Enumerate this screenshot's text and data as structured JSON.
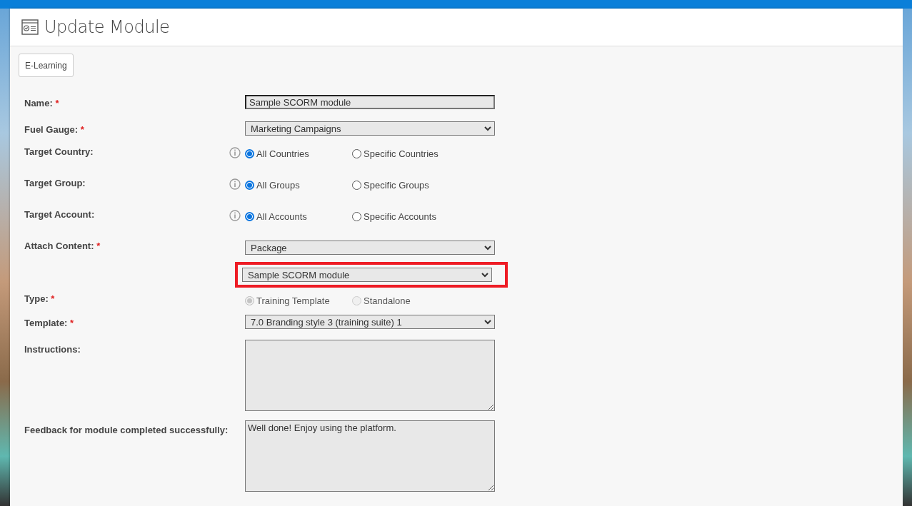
{
  "header": {
    "title": "Update Module"
  },
  "category_button": {
    "label": "E-Learning"
  },
  "fields": [
    {
      "kind": "text",
      "label": "Name:",
      "required_mark": "*",
      "value": "Sample SCORM module"
    },
    {
      "kind": "select",
      "label": "Fuel Gauge:",
      "required_mark": "*",
      "value": "Marketing Campaigns"
    },
    {
      "kind": "radio",
      "label": "Target Country:",
      "info": true,
      "disabled": false,
      "options": [
        {
          "label": "All Countries",
          "selected": true
        },
        {
          "label": "Specific Countries",
          "selected": false
        }
      ]
    },
    {
      "kind": "radio",
      "label": "Target Group:",
      "info": true,
      "disabled": false,
      "options": [
        {
          "label": "All Groups",
          "selected": true
        },
        {
          "label": "Specific Groups",
          "selected": false
        }
      ]
    },
    {
      "kind": "radio",
      "label": "Target Account:",
      "info": true,
      "disabled": false,
      "options": [
        {
          "label": "All Accounts",
          "selected": true
        },
        {
          "label": "Specific Accounts",
          "selected": false
        }
      ]
    },
    {
      "kind": "selects",
      "label": "Attach Content:",
      "required_mark": "*",
      "selects": [
        {
          "value": "Package",
          "highlighted": false
        },
        {
          "value": "Sample SCORM module",
          "highlighted": true
        }
      ]
    },
    {
      "kind": "radio",
      "label": "Type:",
      "required_mark": "*",
      "disabled": true,
      "options": [
        {
          "label": "Training Template",
          "selected": true
        },
        {
          "label": "Standalone",
          "selected": false
        }
      ]
    },
    {
      "kind": "select",
      "label": "Template:",
      "required_mark": "*",
      "value": "7.0 Branding style 3 (training suite) 1"
    },
    {
      "kind": "textarea",
      "label": "Instructions:"
    },
    {
      "kind": "textarea",
      "label": "Feedback for module completed successfully:",
      "value": "Well done! Enjoy using the platform."
    }
  ]
}
